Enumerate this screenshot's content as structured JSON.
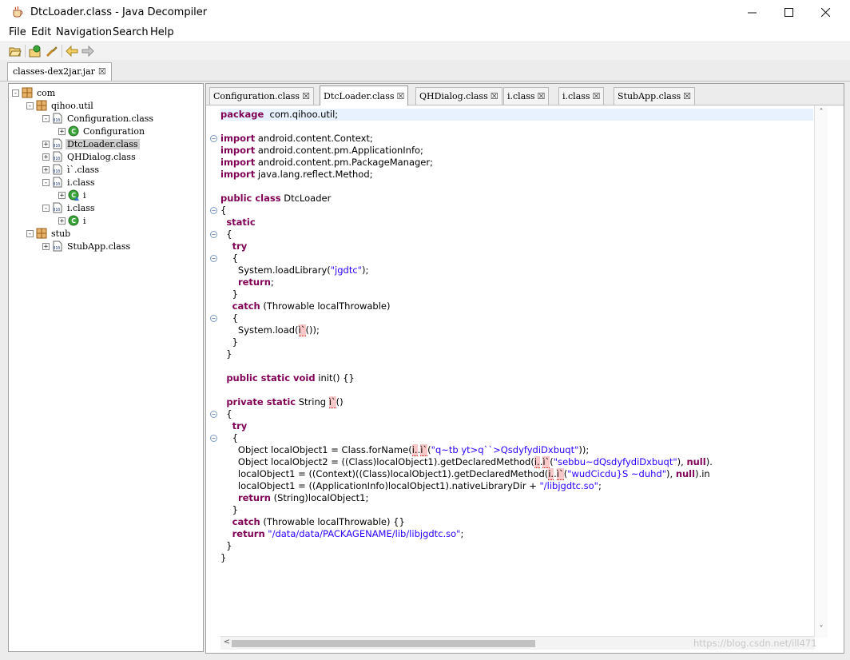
{
  "window": {
    "title": "DtcLoader.class - Java Decompiler",
    "minimize": "—",
    "maximize": "☐",
    "close": "✕"
  },
  "menu": [
    "File",
    "Edit",
    "Navigation",
    "Search",
    "Help"
  ],
  "toolbar": {
    "icons": [
      "open-file-icon",
      "open-type-icon",
      "find-icon",
      "back-icon",
      "forward-icon"
    ]
  },
  "outer_tab": {
    "label": "classes-dex2jar.jar",
    "close": "☒"
  },
  "tree": [
    {
      "label": "com",
      "kind": "package"
    },
    {
      "label": "qihoo.util",
      "kind": "package"
    },
    {
      "label": "Configuration.class",
      "kind": "class-file"
    },
    {
      "label": "Configuration",
      "kind": "class"
    },
    {
      "label": "DtcLoader.class",
      "kind": "class-file"
    },
    {
      "label": "QHDialog.class",
      "kind": "class-file"
    },
    {
      "label": "ì`.class",
      "kind": "class-file"
    },
    {
      "label": "i.class",
      "kind": "class-file"
    },
    {
      "label": "i",
      "kind": "class-inner"
    },
    {
      "label": "i.class",
      "kind": "class-file"
    },
    {
      "label": "i",
      "kind": "class"
    },
    {
      "label": "stub",
      "kind": "package"
    },
    {
      "label": "StubApp.class",
      "kind": "class-file"
    }
  ],
  "editor_tabs": [
    {
      "label": "Configuration.class",
      "close": "☒"
    },
    {
      "label": "DtcLoader.class",
      "close": "☒"
    },
    {
      "label": "QHDialog.class",
      "close": "☒"
    },
    {
      "label": "i.class",
      "close": "☒"
    },
    {
      "label": "i.class",
      "close": "☒"
    },
    {
      "label": "StubApp.class",
      "close": "☒"
    }
  ],
  "code_lines": [
    [
      [
        "kw",
        "package"
      ],
      [
        "",
        "  com.qihoo.util;"
      ]
    ],
    [],
    [
      [
        "kw",
        "import"
      ],
      [
        "",
        " android.content.Context;"
      ]
    ],
    [
      [
        "kw",
        "import"
      ],
      [
        "",
        " android.content.pm.ApplicationInfo;"
      ]
    ],
    [
      [
        "kw",
        "import"
      ],
      [
        "",
        " android.content.pm.PackageManager;"
      ]
    ],
    [
      [
        "kw",
        "import"
      ],
      [
        "",
        " java.lang.reflect.Method;"
      ]
    ],
    [],
    [
      [
        "kw",
        "public class"
      ],
      [
        "",
        " DtcLoader"
      ]
    ],
    [
      [
        "",
        "{"
      ]
    ],
    [
      [
        "",
        "  "
      ],
      [
        "kw",
        "static"
      ]
    ],
    [
      [
        "",
        "  {"
      ]
    ],
    [
      [
        "",
        "    "
      ],
      [
        "kw",
        "try"
      ]
    ],
    [
      [
        "",
        "    {"
      ]
    ],
    [
      [
        "",
        "      System.loadLibrary("
      ],
      [
        "str",
        "\"jgdtc\""
      ],
      [
        "",
        ");"
      ]
    ],
    [
      [
        "",
        "      "
      ],
      [
        "kw",
        "return"
      ],
      [
        "",
        ";"
      ]
    ],
    [
      [
        "",
        "    }"
      ]
    ],
    [
      [
        "",
        "    "
      ],
      [
        "kw",
        "catch"
      ],
      [
        "",
        " (Throwable localThrowable)"
      ]
    ],
    [
      [
        "",
        "    {"
      ]
    ],
    [
      [
        "",
        "      System.load("
      ],
      [
        "err",
        "ì`"
      ],
      [
        "",
        "());"
      ]
    ],
    [
      [
        "",
        "    }"
      ]
    ],
    [
      [
        "",
        "  }"
      ]
    ],
    [],
    [
      [
        "",
        "  "
      ],
      [
        "kw",
        "public static void"
      ],
      [
        "",
        " init() {}"
      ]
    ],
    [],
    [
      [
        "",
        "  "
      ],
      [
        "kw",
        "private static"
      ],
      [
        "",
        " String "
      ],
      [
        "err",
        "ì`"
      ],
      [
        "",
        "()"
      ]
    ],
    [
      [
        "",
        "  {"
      ]
    ],
    [
      [
        "",
        "    "
      ],
      [
        "kw",
        "try"
      ]
    ],
    [
      [
        "",
        "    {"
      ]
    ],
    [
      [
        "",
        "      Object localObject1 = Class.forName("
      ],
      [
        "err",
        "i."
      ],
      [
        "",
        "."
      ],
      [
        "err",
        "ì`"
      ],
      [
        "",
        "("
      ],
      [
        "str",
        "\"q~tb yt>q``>QsdyfydiDxbuqt\""
      ],
      [
        "",
        "));"
      ]
    ],
    [
      [
        "",
        "      Object localObject2 = ((Class)localObject1).getDeclaredMethod("
      ],
      [
        "err",
        "i."
      ],
      [
        "",
        "."
      ],
      [
        "err",
        "ì`"
      ],
      [
        "",
        "("
      ],
      [
        "str",
        "\"sebbu~dQsdyfydiDxbuqt\""
      ],
      [
        "",
        "), "
      ],
      [
        "kw",
        "null"
      ],
      [
        "",
        ")."
      ]
    ],
    [
      [
        "",
        "      localObject1 = ((Context)((Class)localObject1).getDeclaredMethod("
      ],
      [
        "err",
        "i."
      ],
      [
        "",
        "."
      ],
      [
        "err",
        "ì`"
      ],
      [
        "",
        "("
      ],
      [
        "str",
        "\"wudCicdu}S ~duhd\""
      ],
      [
        "",
        "), "
      ],
      [
        "kw",
        "null"
      ],
      [
        "",
        ").in"
      ]
    ],
    [
      [
        "",
        "      localObject1 = ((ApplicationInfo)localObject1).nativeLibraryDir + "
      ],
      [
        "str",
        "\"/libjgdtc.so\""
      ],
      [
        "",
        ";"
      ]
    ],
    [
      [
        "",
        "      "
      ],
      [
        "kw",
        "return"
      ],
      [
        "",
        " (String)localObject1;"
      ]
    ],
    [
      [
        "",
        "    }"
      ]
    ],
    [
      [
        "",
        "    "
      ],
      [
        "kw",
        "catch"
      ],
      [
        "",
        " (Throwable localThrowable) {}"
      ]
    ],
    [
      [
        "",
        "    "
      ],
      [
        "kw",
        "return"
      ],
      [
        "",
        ""
      ],
      [
        "str",
        " \"/data/data/PACKAGENAME/lib/libjgdtc.so\""
      ],
      [
        "",
        ";"
      ]
    ],
    [
      [
        "",
        "  }"
      ]
    ],
    [
      [
        "",
        "}"
      ]
    ]
  ],
  "watermark": "https://blog.csdn.net/ill471"
}
